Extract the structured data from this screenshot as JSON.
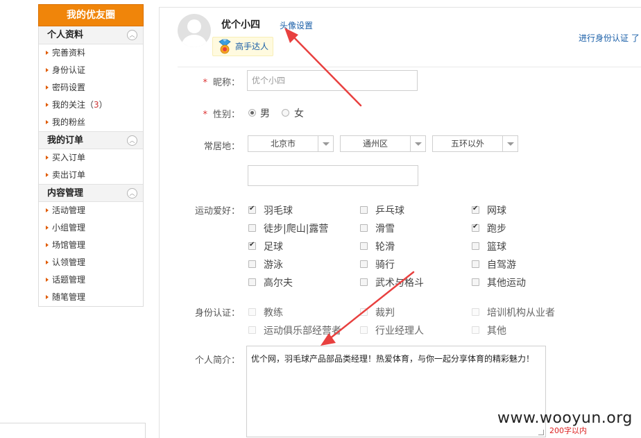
{
  "sidebar": {
    "title": "我的优友圈",
    "sections": [
      {
        "title": "个人资料",
        "items": [
          "完善资料",
          "身份认证",
          "密码设置",
          "我的关注（",
          "我的粉丝"
        ],
        "follow_count": "3",
        "follow_suffix": "）"
      },
      {
        "title": "我的订单",
        "items": [
          "买入订单",
          "卖出订单"
        ]
      },
      {
        "title": "内容管理",
        "items": [
          "活动管理",
          "小组管理",
          "场馆管理",
          "认领管理",
          "话题管理",
          "随笔管理"
        ]
      }
    ],
    "toggle_glyph": "︿"
  },
  "profile": {
    "nickname": "优个小四",
    "avatar_link": "头像设置",
    "badge": "高手达人",
    "verify_link": "进行身份认证",
    "verify_more": "了"
  },
  "form": {
    "required_mark": "*",
    "nick_label": "昵称：",
    "nick_value": "优个小四",
    "gender_label": "性别：",
    "gender_male": "男",
    "gender_female": "女",
    "residence_label": "常居地：",
    "city": "北京市",
    "district": "通州区",
    "area": "五环以外",
    "address_value": "",
    "sports_label": "运动爱好：",
    "sports": [
      {
        "label": "羽毛球",
        "checked": true
      },
      {
        "label": "乒乓球",
        "checked": false
      },
      {
        "label": "网球",
        "checked": true
      },
      {
        "label": "徒步|爬山|露营",
        "checked": false
      },
      {
        "label": "滑雪",
        "checked": false
      },
      {
        "label": "跑步",
        "checked": true
      },
      {
        "label": "足球",
        "checked": true
      },
      {
        "label": "轮滑",
        "checked": false
      },
      {
        "label": "篮球",
        "checked": false
      },
      {
        "label": "游泳",
        "checked": false
      },
      {
        "label": "骑行",
        "checked": false
      },
      {
        "label": "自驾游",
        "checked": false
      },
      {
        "label": "高尔夫",
        "checked": false
      },
      {
        "label": "武术与格斗",
        "checked": false
      },
      {
        "label": "其他运动",
        "checked": false
      }
    ],
    "identity_label": "身份认证：",
    "identities": [
      "教练",
      "裁判",
      "培训机构从业者",
      "运动俱乐部经营者",
      "行业经理人",
      "其他"
    ],
    "intro_label": "个人简介：",
    "intro_text": "优个网，羽毛球产品部品类经理！热爱体育，与你一起分享体育的精彩魅力！",
    "char_limit": "200字以内"
  },
  "watermark": "www.wooyun.org",
  "colors": {
    "accent": "#f0850a",
    "link": "#1a5fa8",
    "arrow": "#e8403f"
  }
}
